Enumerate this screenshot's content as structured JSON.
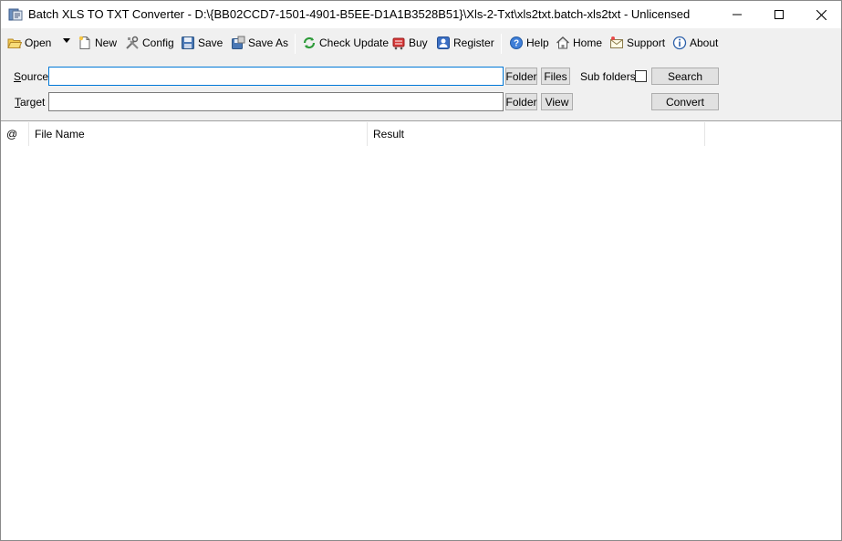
{
  "window": {
    "title": "Batch XLS TO TXT Converter - D:\\{BB02CCD7-1501-4901-B5EE-D1A1B3528B51}\\Xls-2-Txt\\xls2txt.batch-xls2txt - Unlicensed"
  },
  "toolbar": {
    "open": "Open",
    "new": "New",
    "config": "Config",
    "save": "Save",
    "save_as": "Save As",
    "check_update": "Check Update",
    "buy": "Buy",
    "register": "Register",
    "help": "Help",
    "home": "Home",
    "support": "Support",
    "about": "About"
  },
  "options": {
    "source_label_first": "S",
    "source_label_rest": "ource",
    "source_value": "",
    "target_label_first": "T",
    "target_label_rest": "arget",
    "target_value": "",
    "source_folder": "Folder",
    "source_files": "Files",
    "sub_folders": "Sub folders",
    "search": "Search",
    "target_folder": "Folder",
    "target_view": "View",
    "convert": "Convert"
  },
  "list": {
    "columns": [
      "@",
      "File Name",
      "Result"
    ]
  },
  "colors": {
    "toolbar_bg": "#f0f0f0",
    "focus_border": "#0078d7"
  }
}
